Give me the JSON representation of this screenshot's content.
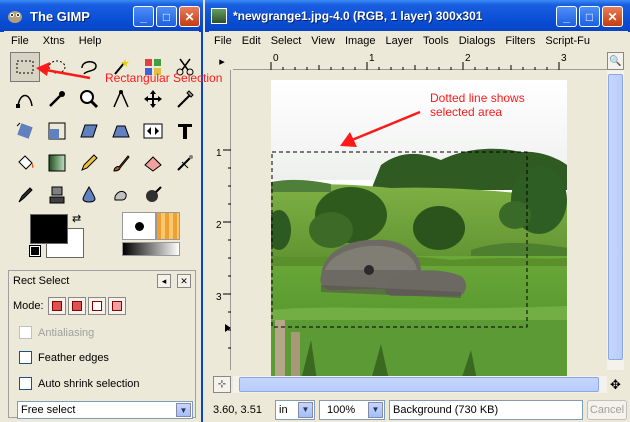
{
  "toolbox": {
    "title": "The GIMP",
    "menu": [
      "File",
      "Xtns",
      "Help"
    ],
    "tools": [
      "rect-select-icon",
      "ellipse-select-icon",
      "lasso-icon",
      "fuzzy-select-icon",
      "select-by-color-icon",
      "scissors-icon",
      "paths-icon",
      "color-picker-icon",
      "magnify-icon",
      "measure-icon",
      "move-icon",
      "crop-icon",
      "rotate-icon",
      "scale-icon",
      "shear-icon",
      "perspective-icon",
      "flip-icon",
      "text-icon",
      "bucket-fill-icon",
      "blend-icon",
      "pencil-icon",
      "paintbrush-icon",
      "eraser-icon",
      "airbrush-icon",
      "ink-icon",
      "clone-icon",
      "blur-icon",
      "smudge-icon",
      "dodge-burn-icon"
    ],
    "options": {
      "title": "Rect Select",
      "mode_label": "Mode:",
      "antialiasing": "Antialiasing",
      "feather": "Feather edges",
      "autoshrink": "Auto shrink selection",
      "select_value": "Free select"
    }
  },
  "image_window": {
    "title": "*newgrange1.jpg-4.0 (RGB, 1 layer) 300x301",
    "menu": [
      "File",
      "Edit",
      "Select",
      "View",
      "Image",
      "Layer",
      "Tools",
      "Dialogs",
      "Filters",
      "Script-Fu"
    ],
    "ruler_h": [
      "0",
      "1",
      "2",
      "3"
    ],
    "ruler_v": [
      "1",
      "2",
      "3"
    ],
    "status": {
      "coords": "3.60, 3.51",
      "unit": "in",
      "zoom": "100%",
      "layer_info": "Background (730 KB)",
      "cancel": "Cancel"
    }
  },
  "annotations": {
    "rect_label": "Rectangular Selection",
    "dotted_line1": "Dotted line shows",
    "dotted_line2": "selected area"
  },
  "colors": {
    "annotation": "#ff1a1a",
    "titlebar": "#0a4fd6"
  }
}
